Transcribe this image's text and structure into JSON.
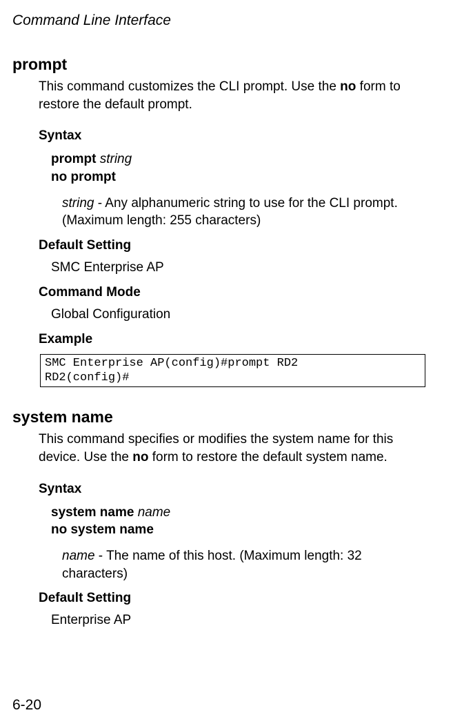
{
  "page_header": "Command Line Interface",
  "page_number": "6-20",
  "commands": [
    {
      "name": "prompt",
      "desc_prefix": "This command customizes the CLI prompt. Use the ",
      "desc_bold": "no",
      "desc_suffix": " form to restore the default prompt.",
      "syntax_heading": "Syntax",
      "syntax_line1_kw": "prompt",
      "syntax_line1_arg": "string",
      "syntax_line2_kw": "no prompt",
      "param_arg": "string",
      "param_desc": " - Any alphanumeric string to use for the CLI prompt. (Maximum length: 255 characters)",
      "default_heading": "Default Setting",
      "default_value": "SMC Enterprise AP",
      "mode_heading": "Command Mode",
      "mode_value": "Global Configuration",
      "example_heading": "Example",
      "example_text": "SMC Enterprise AP(config)#prompt RD2\nRD2(config)#"
    },
    {
      "name": "system name",
      "desc_prefix": "This command specifies or modifies the system name for this device. Use the ",
      "desc_bold": "no",
      "desc_suffix": " form to restore the default system name.",
      "syntax_heading": "Syntax",
      "syntax_line1_kw": "system name",
      "syntax_line1_arg": "name",
      "syntax_line2_kw": "no system name",
      "param_arg": "name",
      "param_desc": " - The name of this host. (Maximum length: 32 characters)",
      "default_heading": "Default Setting",
      "default_value": "Enterprise AP"
    }
  ]
}
